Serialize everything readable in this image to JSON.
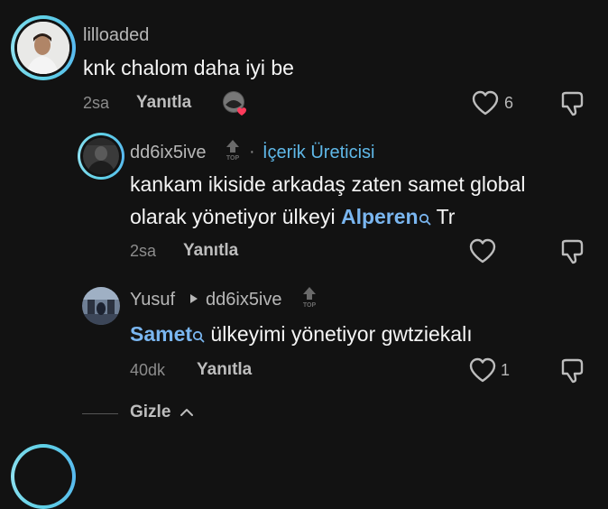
{
  "comments": [
    {
      "username": "lilloaded",
      "text": "knk chalom daha iyi be",
      "time": "2sa",
      "reply_label": "Yanıtla",
      "likes": "6"
    },
    {
      "username": "dd6ix5ive",
      "badge_top": "TOP",
      "separator": "·",
      "role": "İçerik Üreticisi",
      "text_line1": "kankam ikiside arkadaş zaten samet global",
      "text_line2_prefix": "olarak yönetiyor ülkeyi ",
      "mention": "Alperen",
      "text_line2_suffix": " Tr",
      "time": "2sa",
      "reply_label": "Yanıtla"
    },
    {
      "username": "Yusuf",
      "reply_to": "dd6ix5ive",
      "badge_top": "TOP",
      "mention": "Samet",
      "text": " ülkeyimi yönetiyor gwtziekalı",
      "time": "40dk",
      "reply_label": "Yanıtla",
      "likes": "1"
    }
  ],
  "hide_label": "Gizle",
  "icons": {
    "heart": "heart-icon",
    "dislike": "thumbs-down-icon",
    "search": "search-icon",
    "top": "top-arrow-icon",
    "caret": "caret-right-icon",
    "chevron": "chevron-up-icon"
  },
  "colors": {
    "background": "#121212",
    "ring": "#5fd0e6",
    "mention": "#7ab6f0",
    "creator": "#5fb8e8"
  }
}
